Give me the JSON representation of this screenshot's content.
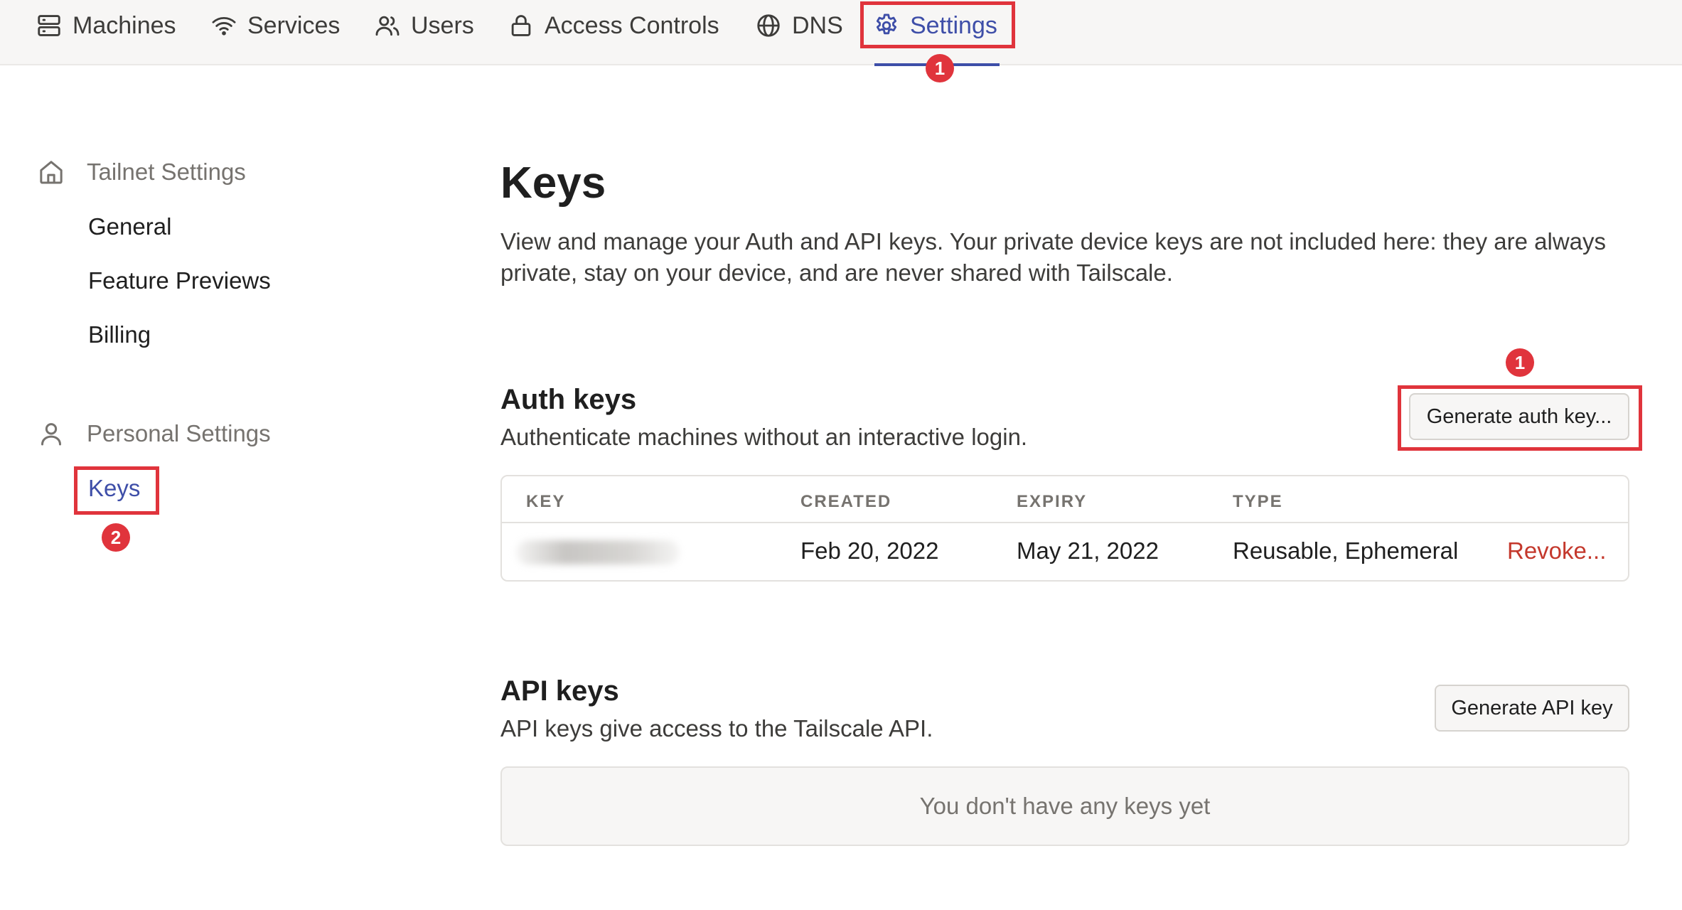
{
  "nav": {
    "items": [
      {
        "label": "Machines",
        "icon": "server-icon"
      },
      {
        "label": "Services",
        "icon": "wifi-icon"
      },
      {
        "label": "Users",
        "icon": "users-icon"
      },
      {
        "label": "Access Controls",
        "icon": "lock-icon"
      },
      {
        "label": "DNS",
        "icon": "globe-icon"
      },
      {
        "label": "Settings",
        "icon": "gear-icon",
        "active": true
      }
    ],
    "accent_color": "#3e4ea8"
  },
  "sidebar": {
    "tailnet_heading": "Tailnet Settings",
    "tailnet_icon": "home-icon",
    "tailnet_links": [
      "General",
      "Feature Previews",
      "Billing"
    ],
    "personal_heading": "Personal Settings",
    "personal_icon": "user-icon",
    "personal_links": [
      "Keys"
    ]
  },
  "main": {
    "title": "Keys",
    "description": "View and manage your Auth and API keys. Your private device keys are not included here: they are always private, stay on your device, and are never shared with Tailscale.",
    "auth_keys": {
      "title": "Auth keys",
      "description": "Authenticate machines without an interactive login.",
      "button_label": "Generate auth key...",
      "columns": [
        "KEY",
        "CREATED",
        "EXPIRY",
        "TYPE"
      ],
      "rows": [
        {
          "created": "Feb 20, 2022",
          "expiry": "May 21, 2022",
          "type": "Reusable, Ephemeral",
          "action": "Revoke..."
        }
      ]
    },
    "api_keys": {
      "title": "API keys",
      "description": "API keys give access to the Tailscale API.",
      "button_label": "Generate API key",
      "empty_text": "You don't have any keys yet"
    }
  },
  "annotations": {
    "badges": [
      "1",
      "1",
      "2"
    ],
    "highlight_color": "#e0343c"
  }
}
